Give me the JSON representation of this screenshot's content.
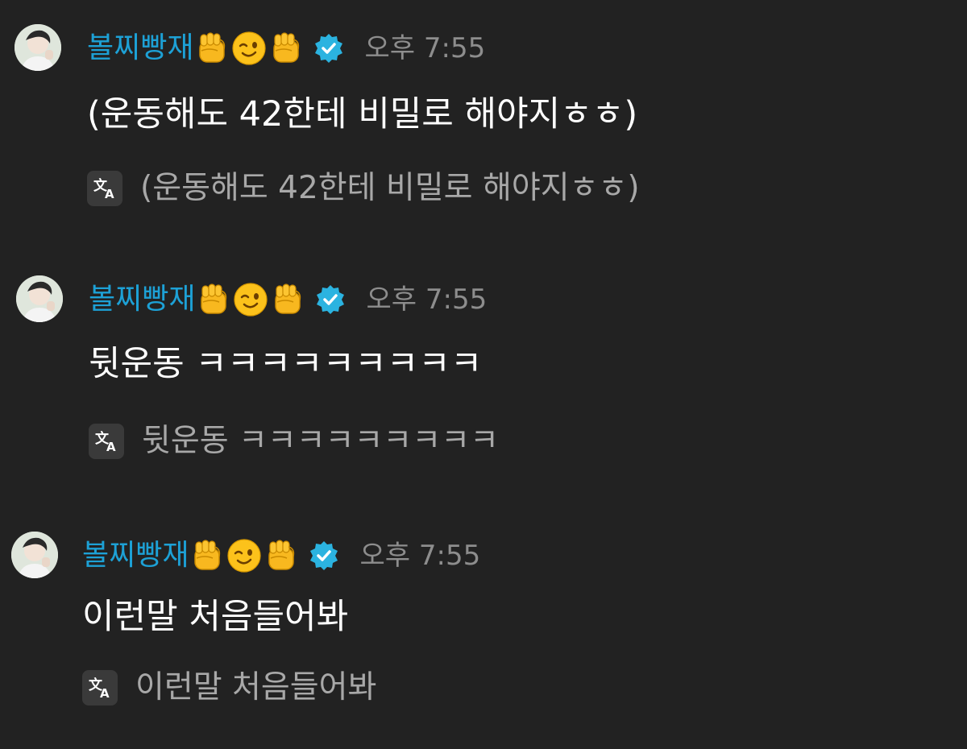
{
  "messages": [
    {
      "username": "볼찌빵재",
      "emojis": [
        "raised-fist-icon",
        "winking-face-icon",
        "raised-fist-icon"
      ],
      "verified": true,
      "timestamp": "오후 7:55",
      "text": "(운동해도 42한테 비밀로 해야지ㅎㅎ)",
      "translation": "(운동해도 42한테 비밀로 해야지ㅎㅎ)"
    },
    {
      "username": "볼찌빵재",
      "emojis": [
        "raised-fist-icon",
        "winking-face-icon",
        "raised-fist-icon"
      ],
      "verified": true,
      "timestamp": "오후 7:55",
      "text": "뒷운동 ㅋㅋㅋㅋㅋㅋㅋㅋㅋ",
      "translation": "뒷운동 ㅋㅋㅋㅋㅋㅋㅋㅋㅋ"
    },
    {
      "username": "볼찌빵재",
      "emojis": [
        "raised-fist-icon",
        "winking-face-icon",
        "raised-fist-icon"
      ],
      "verified": true,
      "timestamp": "오후 7:55",
      "text": "이런말 처음들어봐",
      "translation": "이런말 처음들어봐"
    }
  ],
  "colors": {
    "background": "#222222",
    "username": "#1da1d6",
    "timestamp": "#8d8d8d",
    "message_text": "#ffffff",
    "translation_text": "#a8a8a8",
    "verified_badge": "#2bb3e0"
  }
}
